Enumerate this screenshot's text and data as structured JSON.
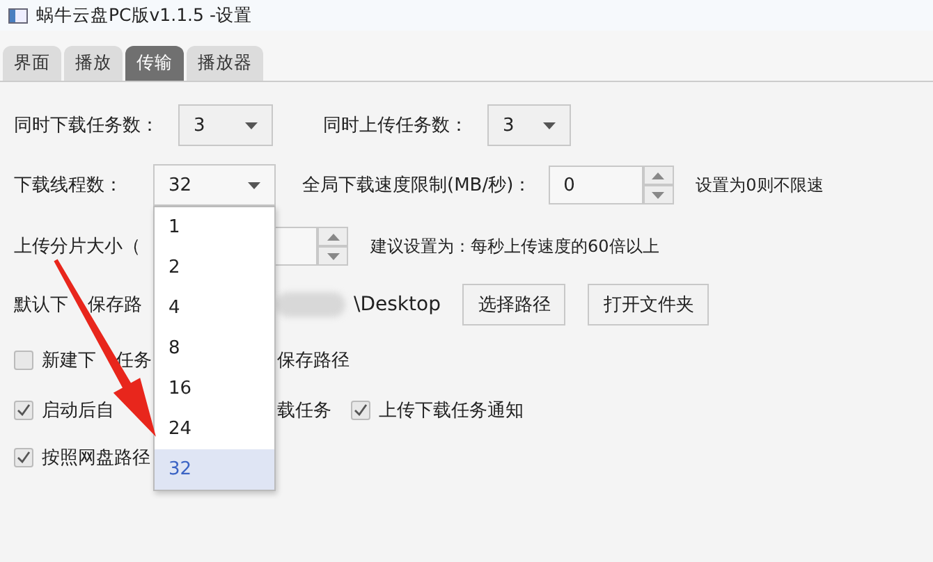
{
  "window": {
    "title": "蜗牛云盘PC版v1.1.5 -设置"
  },
  "tabs": [
    {
      "label": "界面",
      "selected": false
    },
    {
      "label": "播放",
      "selected": false
    },
    {
      "label": "传输",
      "selected": true
    },
    {
      "label": "播放器",
      "selected": false
    }
  ],
  "concurrency": [
    {
      "label": "同时下载任务数：",
      "value": "3"
    },
    {
      "label": "同时上传任务数：",
      "value": "3"
    }
  ],
  "threads": {
    "label": "下载线程数：",
    "value": "32",
    "options": [
      {
        "label": "1",
        "selected": false
      },
      {
        "label": "2",
        "selected": false
      },
      {
        "label": "4",
        "selected": false
      },
      {
        "label": "8",
        "selected": false
      },
      {
        "label": "16",
        "selected": false
      },
      {
        "label": "24",
        "selected": false
      },
      {
        "label": "32",
        "selected": true
      }
    ]
  },
  "speed_limit": {
    "label": "全局下载速度限制(MB/秒)：",
    "value": "0",
    "hint": "设置为0则不限速"
  },
  "chunk_size": {
    "label": "上传分片大小（",
    "hint": "建议设置为：每秒上传速度的60倍以上"
  },
  "save_path": {
    "label_parts": [
      "默认下",
      "保存路"
    ],
    "value": "\\Desktop",
    "buttons": [
      "选择路径",
      "打开文件夹"
    ]
  },
  "option_rows": [
    [
      {
        "label_parts": [
          "新建下",
          "任务"
        ],
        "label_2": "保存路径",
        "checked": false
      }
    ],
    [
      {
        "label_parts": [
          "启动后自"
        ],
        "label_2": "载任务",
        "checked": true
      },
      {
        "label": "上传下载任务通知",
        "checked": true
      }
    ],
    [
      {
        "label_parts": [
          "按照网盘路径"
        ],
        "checked": true
      }
    ]
  ]
}
